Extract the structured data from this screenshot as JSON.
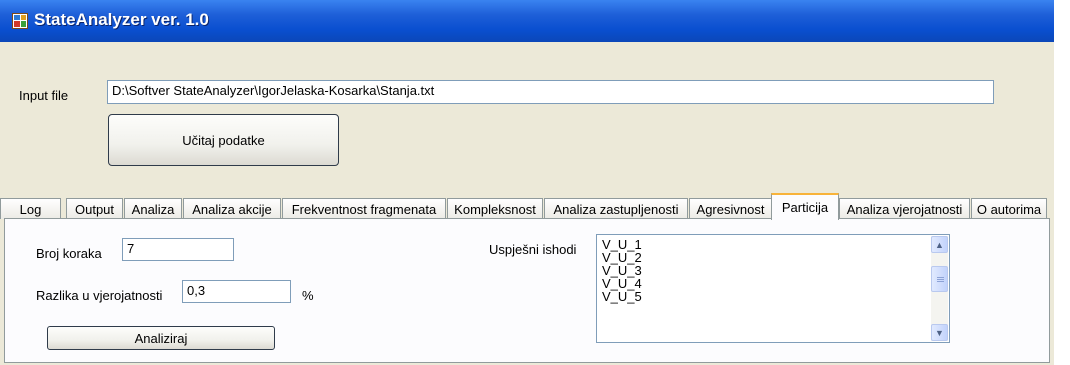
{
  "window": {
    "title": "StateAnalyzer ver. 1.0"
  },
  "input_file": {
    "label": "Input file",
    "value": "D:\\Softver StateAnalyzer\\IgorJelaska-Kosarka\\Stanja.txt"
  },
  "load_button": {
    "label": "Učitaj podatke"
  },
  "tabs": [
    {
      "label": "Log"
    },
    {
      "label": "Output"
    },
    {
      "label": "Analiza"
    },
    {
      "label": "Analiza akcije"
    },
    {
      "label": "Frekventnost fragmenata"
    },
    {
      "label": "Kompleksnost"
    },
    {
      "label": "Analiza zastupljenosti"
    },
    {
      "label": "Agresivnost"
    },
    {
      "label": "Particija",
      "active": true
    },
    {
      "label": "Analiza vjerojatnosti"
    },
    {
      "label": "O autorima"
    }
  ],
  "particija": {
    "steps_label": "Broj koraka",
    "steps_value": "7",
    "prob_diff_label": "Razlika u vjerojatnosti",
    "prob_diff_value": "0,3",
    "percent_label": "%",
    "analyze_button": "Analiziraj",
    "outcomes_label": "Uspješni ishodi",
    "outcomes": [
      "V_U_1",
      "V_U_2",
      "V_U_3",
      "V_U_4",
      "V_U_5"
    ]
  }
}
